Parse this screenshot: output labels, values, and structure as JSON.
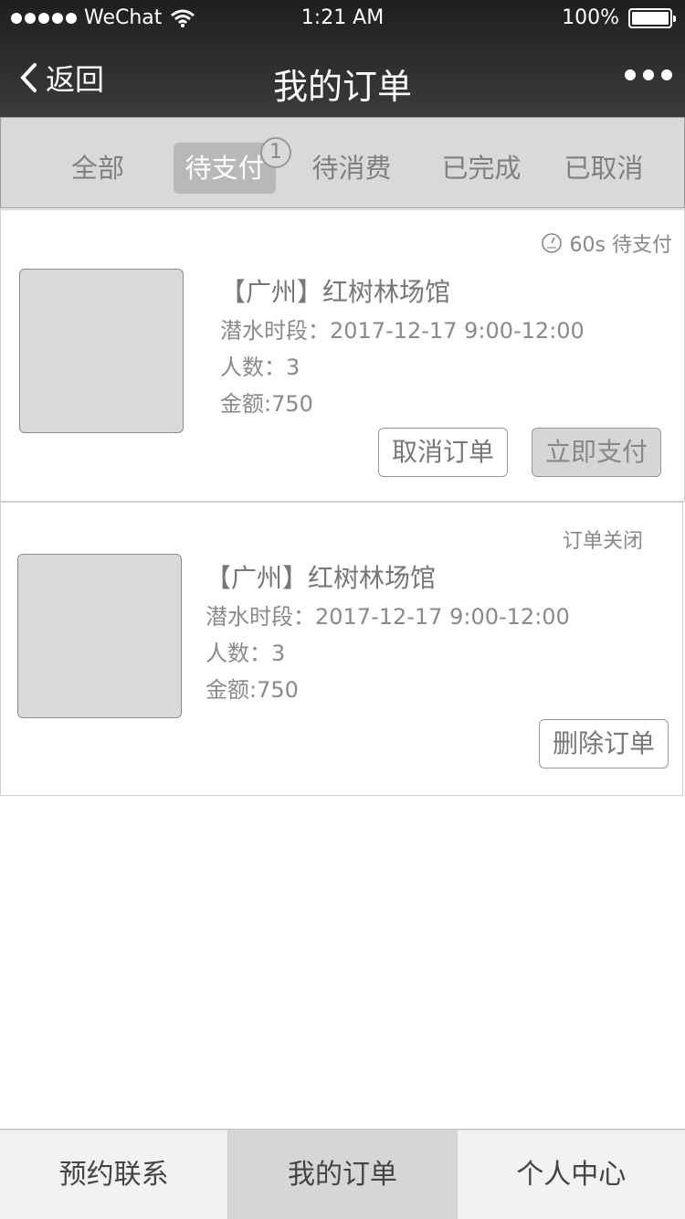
{
  "status_bar": {
    "carrier": "WeChat",
    "time": "1:21 AM",
    "battery": "100%"
  },
  "nav": {
    "back_label": "返回",
    "title": "我的订单"
  },
  "tabs": [
    {
      "label": "全部"
    },
    {
      "label": "待支付",
      "badge": "1"
    },
    {
      "label": "待消费"
    },
    {
      "label": "已完成"
    },
    {
      "label": "已取消"
    }
  ],
  "orders": [
    {
      "status": "60s 待支付",
      "title": "【广州】红树林场馆",
      "time_slot": "潜水时段：2017-12-17 9:00-12:00",
      "people": "人数：3",
      "amount": "金额:750",
      "buttons": [
        "取消订单",
        "立即支付"
      ]
    },
    {
      "status": "订单关闭",
      "title": "【广州】红树林场馆",
      "time_slot": "潜水时段：2017-12-17 9:00-12:00",
      "people": "人数：3",
      "amount": "金额:750",
      "buttons": [
        "删除订单"
      ]
    }
  ],
  "bottom_nav": [
    {
      "label": "预约联系"
    },
    {
      "label": "我的订单"
    },
    {
      "label": "个人中心"
    }
  ]
}
